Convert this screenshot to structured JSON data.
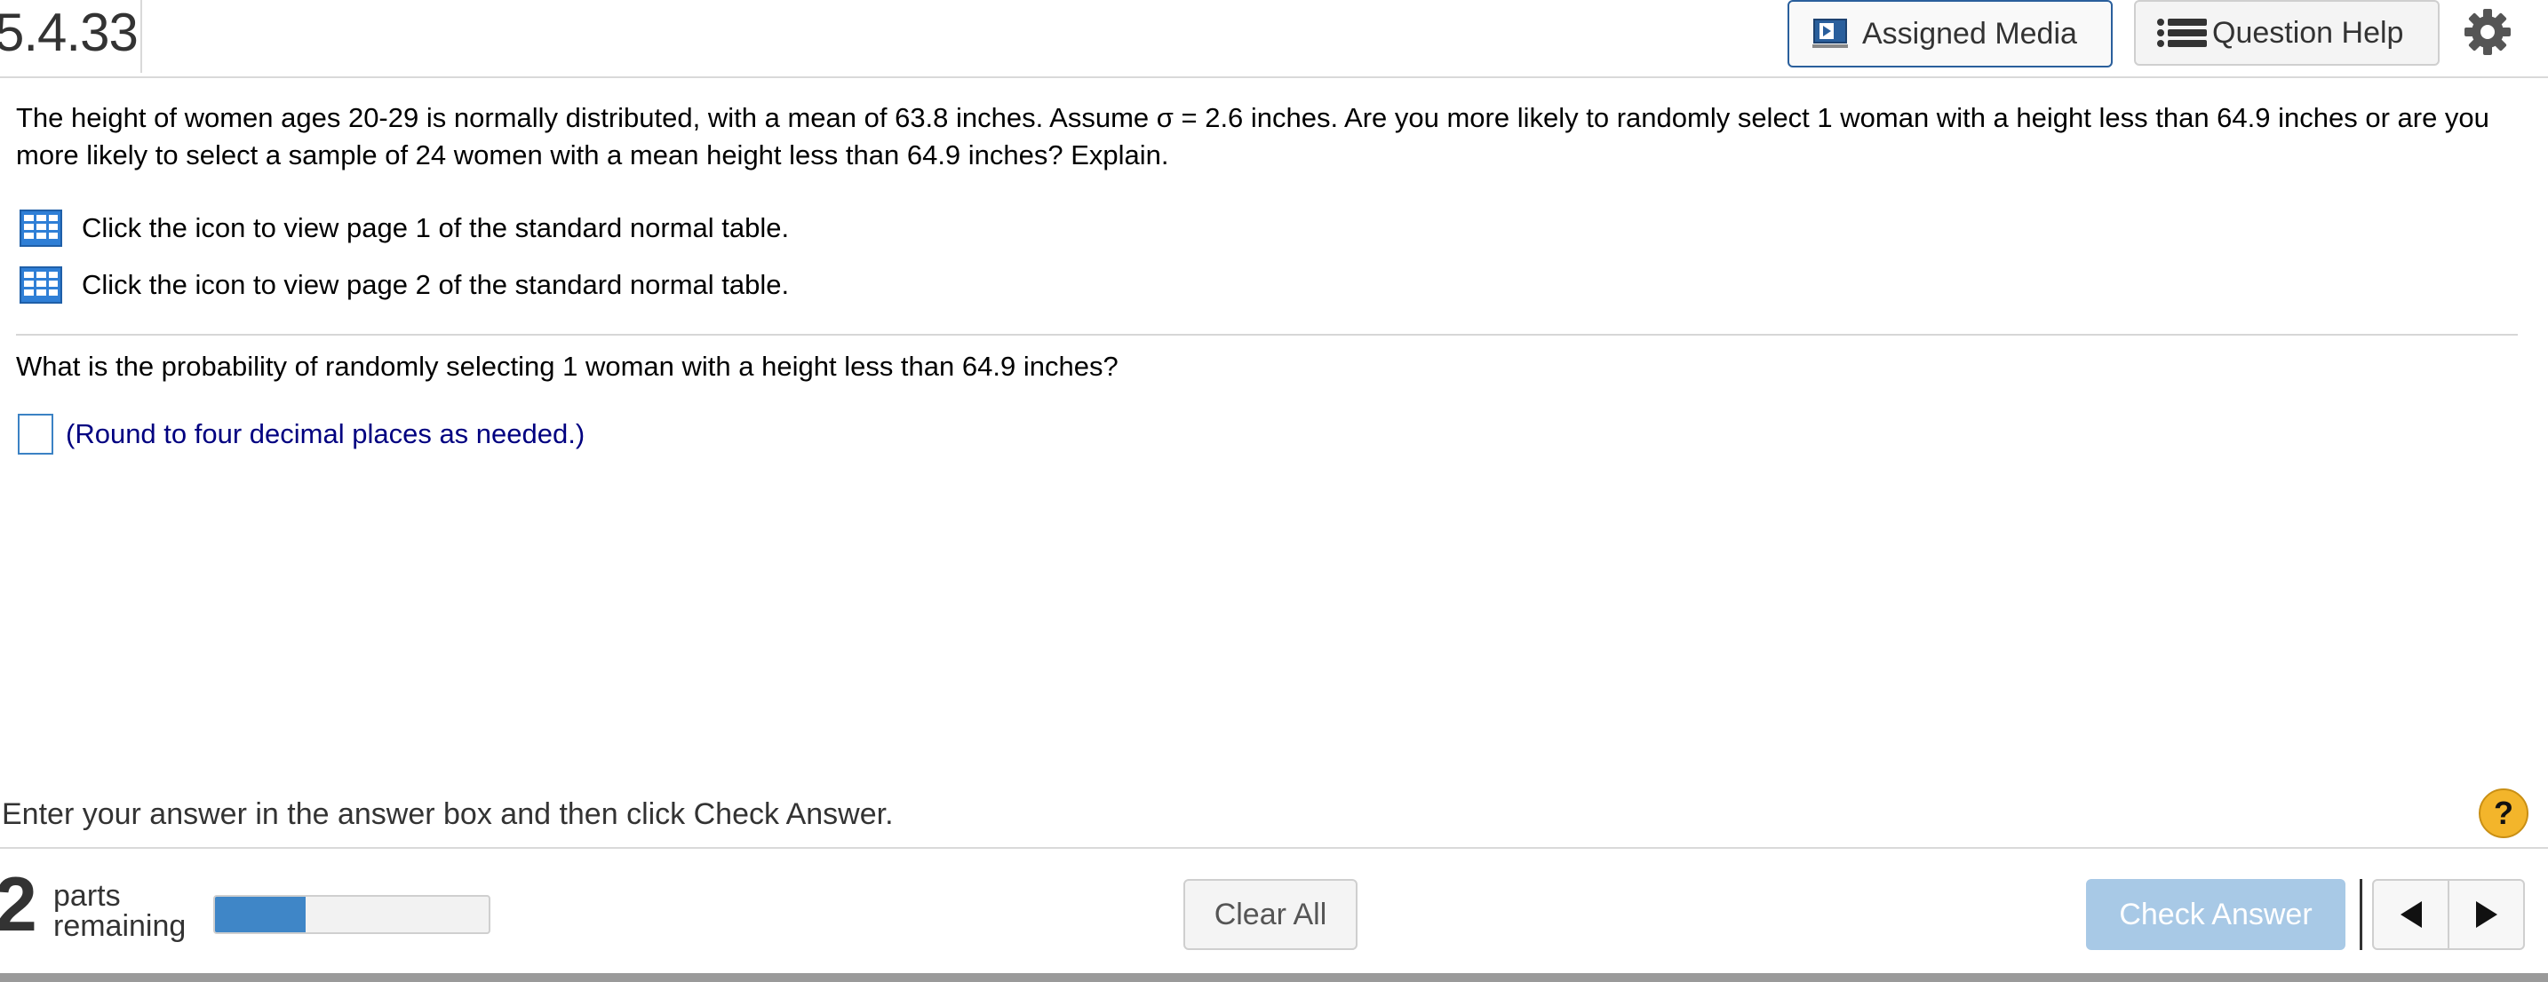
{
  "header": {
    "question_number": "5.4.33",
    "assigned_media_label": "Assigned Media",
    "question_help_label": "Question Help",
    "icons": [
      "media-icon",
      "list-icon",
      "gear-icon"
    ]
  },
  "question": {
    "stem": "The height of women ages 20-29 is normally distributed, with a mean of 63.8 inches. Assume σ = 2.6 inches. Are you more likely to randomly select 1 woman with a height less than 64.9 inches or are you more likely to select a sample of 24 women with a mean height less than 64.9 inches? Explain.",
    "table_links": [
      {
        "label": "Click the icon to view page 1 of the standard normal table.",
        "icon": "table-icon"
      },
      {
        "label": "Click the icon to view page 2 of the standard normal table.",
        "icon": "table-icon"
      }
    ],
    "prompt": "What is the probability of randomly selecting 1 woman with a height less than 64.9 inches?",
    "answer_value": "",
    "answer_hint": "(Round to four decimal places as needed.)"
  },
  "instruction": {
    "text": "Enter your answer in the answer box and then click Check Answer.",
    "help_symbol": "?"
  },
  "footer": {
    "parts_count": "2",
    "parts_word": "parts",
    "remaining_word": "remaining",
    "progress_fraction": 0.33,
    "clear_all_label": "Clear All",
    "check_answer_label": "Check Answer",
    "icons": [
      "prev-arrow-icon",
      "next-arrow-icon"
    ]
  },
  "colors": {
    "accent_blue": "#3f86c7",
    "hint_navy": "#000080",
    "check_answer_disabled": "#a8c9e6",
    "help_circle": "#f3b52b"
  }
}
